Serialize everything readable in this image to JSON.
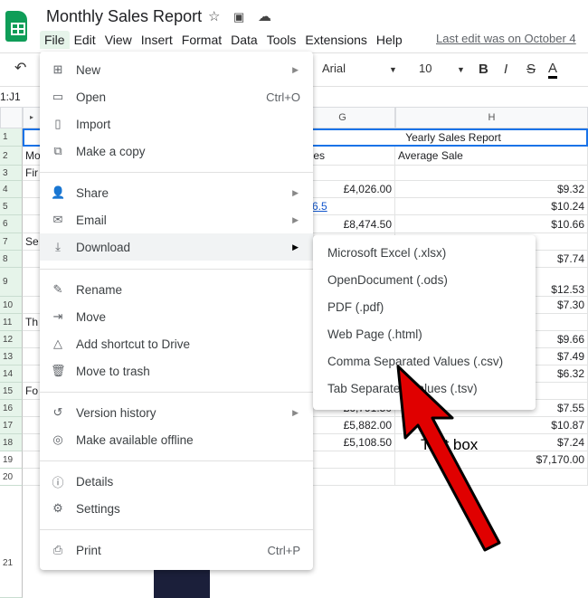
{
  "app": {
    "title": "Monthly Sales Report",
    "last_edit": "Last edit was on October 4",
    "name_box": "1:J1"
  },
  "menubar": [
    "File",
    "Edit",
    "View",
    "Insert",
    "Format",
    "Data",
    "Tools",
    "Extensions",
    "Help"
  ],
  "toolbar": {
    "font": "Arial",
    "size": "10",
    "bold": "B",
    "italic": "I",
    "strike": "S",
    "color": "A"
  },
  "columns": {
    "g": "G",
    "h": "H"
  },
  "sheet": {
    "merged_title": "Yearly Sales Report",
    "g2": "l Sales",
    "h2": "Average Sale",
    "a": {
      "2": "Mo",
      "3": "Fir",
      "7": "Se",
      "11": "Th",
      "15": "Fo"
    },
    "g": {
      "4": "£4,026.00",
      "5": "6.5",
      "6": "£8,474.50",
      "16": "£6,791.50",
      "17": "£5,882.00",
      "18": "£5,108.50"
    },
    "h": {
      "4": "$9.32",
      "5": "$10.24",
      "6": "$10.66",
      "8": "$7.74",
      "9": "$12.53",
      "10": "$7.30",
      "12": "$9.66",
      "13": "$7.49",
      "14": "$6.32",
      "16": "$7.55",
      "17": "$10.87",
      "18": "$7.24",
      "19": "$7,170.00"
    },
    "rows": [
      "1",
      "2",
      "3",
      "4",
      "5",
      "6",
      "7",
      "8",
      "9",
      "10",
      "11",
      "12",
      "13",
      "14",
      "15",
      "16",
      "17",
      "18",
      "19",
      "20",
      "21"
    ]
  },
  "file_menu": [
    {
      "label": "New",
      "icon": "new-sheet-icon",
      "submenu": true
    },
    {
      "label": "Open",
      "icon": "folder-icon",
      "shortcut": "Ctrl+O"
    },
    {
      "label": "Import",
      "icon": "file-icon"
    },
    {
      "label": "Make a copy",
      "icon": "copy-icon"
    },
    {
      "label": "Share",
      "icon": "person-add-icon",
      "submenu": true
    },
    {
      "label": "Email",
      "icon": "mail-icon",
      "submenu": true
    },
    {
      "label": "Download",
      "icon": "download-icon",
      "submenu": true,
      "highlighted": true
    },
    {
      "label": "Rename",
      "icon": "pencil-icon"
    },
    {
      "label": "Move",
      "icon": "move-folder-icon"
    },
    {
      "label": "Add shortcut to Drive",
      "icon": "drive-shortcut-icon"
    },
    {
      "label": "Move to trash",
      "icon": "trash-icon"
    },
    {
      "label": "Version history",
      "icon": "history-icon",
      "submenu": true
    },
    {
      "label": "Make available offline",
      "icon": "offline-icon"
    },
    {
      "label": "Details",
      "icon": "info-icon"
    },
    {
      "label": "Settings",
      "icon": "gear-icon"
    },
    {
      "label": "Print",
      "icon": "printer-icon",
      "shortcut": "Ctrl+P"
    }
  ],
  "download_menu": [
    "Microsoft Excel (.xlsx)",
    "OpenDocument (.ods)",
    "PDF (.pdf)",
    "Web Page (.html)",
    "Comma Separated Values (.csv)",
    "Tab Separated Values (.tsv)"
  ],
  "annotation": {
    "text": "Text box",
    "arrow_color": "#e00000"
  }
}
